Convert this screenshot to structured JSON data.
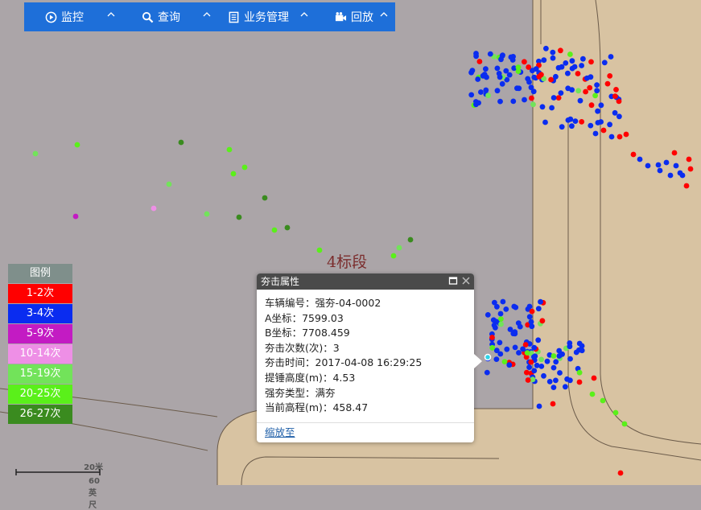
{
  "toolbar": {
    "items": [
      {
        "label": "监控",
        "icon": "play-circle-icon"
      },
      {
        "label": "查询",
        "icon": "search-icon"
      },
      {
        "label": "业务管理",
        "icon": "document-icon"
      },
      {
        "label": "回放",
        "icon": "video-camera-icon"
      }
    ]
  },
  "map": {
    "segment_label": "4标段",
    "colors": {
      "ground": "#aba5a8",
      "road": "#d8c3a2",
      "road_edge": "#6b5b4a"
    }
  },
  "legend": {
    "title": "图例",
    "items": [
      {
        "label": "1-2次",
        "color": "#ff0000"
      },
      {
        "label": "3-4次",
        "color": "#0a2cf0"
      },
      {
        "label": "5-9次",
        "color": "#c31bc3"
      },
      {
        "label": "10-14次",
        "color": "#ee8fe6"
      },
      {
        "label": "15-19次",
        "color": "#72e35a"
      },
      {
        "label": "20-25次",
        "color": "#5af01a"
      },
      {
        "label": "26-27次",
        "color": "#3a8b1f"
      }
    ]
  },
  "popup": {
    "title": "夯击属性",
    "rows": [
      {
        "label": "车辆编号",
        "value": "强夯-04-0002"
      },
      {
        "label": "A坐标",
        "value": "7599.03"
      },
      {
        "label": "B坐标",
        "value": "7708.459"
      },
      {
        "label": "夯击次数(次)",
        "value": "3"
      },
      {
        "label": "夯击时间",
        "value": "2017-04-08 16:29:25"
      },
      {
        "label": "提锤高度(m)",
        "value": "4.53"
      },
      {
        "label": "强夯类型",
        "value": "满夯"
      },
      {
        "label": "当前高程(m)",
        "value": "458.47"
      }
    ],
    "link": "缩放至"
  },
  "scale": {
    "metric": "20米",
    "imperial": "60英尺"
  }
}
